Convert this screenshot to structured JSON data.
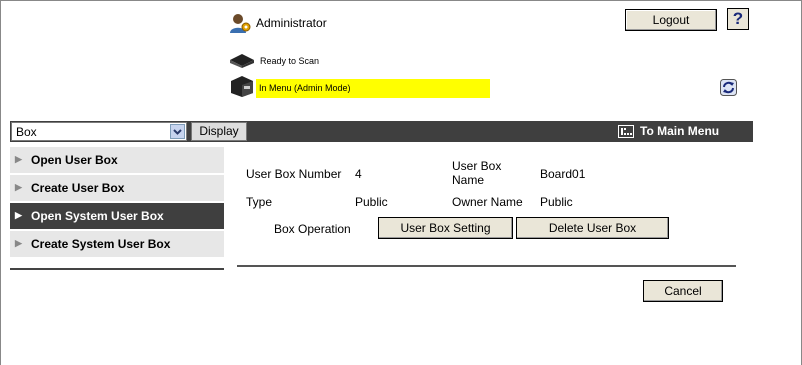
{
  "header": {
    "user_label": "Administrator",
    "logout_label": "Logout",
    "help_label": "?"
  },
  "status": {
    "scan_status": "Ready to Scan",
    "mode_status": "In Menu (Admin Mode)"
  },
  "navbar": {
    "box_select_value": "Box",
    "display_label": "Display",
    "main_menu_label": "To Main Menu"
  },
  "sidebar": {
    "items": [
      {
        "label": "Open User Box",
        "active": false
      },
      {
        "label": "Create User Box",
        "active": false
      },
      {
        "label": "Open System User Box",
        "active": true
      },
      {
        "label": "Create System User Box",
        "active": false
      }
    ]
  },
  "details": {
    "box_number_label": "User Box Number",
    "box_number_value": "4",
    "box_name_label": "User Box Name",
    "box_name_value": "Board01",
    "type_label": "Type",
    "type_value": "Public",
    "owner_label": "Owner Name",
    "owner_value": "Public",
    "operation_label": "Box Operation",
    "setting_button": "User Box Setting",
    "delete_button": "Delete User Box"
  },
  "footer": {
    "cancel_label": "Cancel"
  },
  "colors": {
    "navbar": "#3f3f3f",
    "mode_highlight": "#ffff00",
    "sidebar_bg": "#e7e7e7",
    "button_bg": "#eae6d8"
  }
}
